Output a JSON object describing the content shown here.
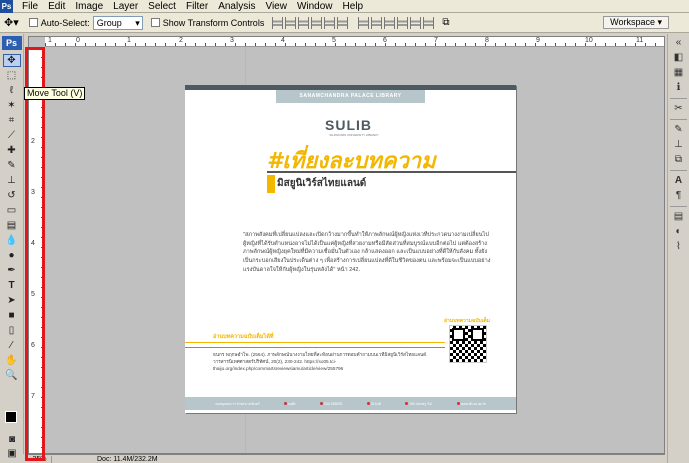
{
  "menu": [
    "File",
    "Edit",
    "Image",
    "Layer",
    "Select",
    "Filter",
    "Analysis",
    "View",
    "Window",
    "Help"
  ],
  "options": {
    "auto_select_label": "Auto-Select:",
    "auto_select_value": "Group",
    "transform_label": "Show Transform Controls",
    "workspace_label": "Workspace"
  },
  "tools": {
    "ps_badge": "Ps",
    "tooltip": "Move Tool (V)"
  },
  "ruler": {
    "top": [
      "1",
      "0",
      "1",
      "2",
      "3",
      "4",
      "5",
      "6",
      "7",
      "8",
      "9",
      "10",
      "11"
    ],
    "left": [
      "1",
      "2",
      "3",
      "4",
      "5",
      "6",
      "7"
    ]
  },
  "document": {
    "library_banner": "SANAMCHANDRA PALACE LIBRARY",
    "logo": "SULIB",
    "logo_sub": "SILPAKORN UNIVERSITY LIBRARY",
    "title": "#เที่ยงละบทความ",
    "subtitle": "มิสยูนิเวิร์สไทยแลนด์",
    "quote": "\"สภาพสังคมที่เปลี่ยนแปลงและเปิดกว้างมากขึ้นทำให้ภาพลักษณ์ผู้หญิงแห่งเวทีประกวดนางงามเปลี่ยนไป ผู้หญิงที่ได้รับตำแหน่งอาจไม่ได้เป็นแค่ผู้หญิงที่สวยงามหรือมีสัดส่วนที่สมบูรณ์แบบอีกต่อไป แต่ต้องสร้างภาพลักษณ์ผู้หญิงยุคใหม่ที่มีความเชื่อมั่นในตัวเอง กล้าแสดงออก และเป็นแบบอย่างที่ดีให้กับสังคม ทั้งยังเป็นกระบอกเสียงในประเด็นต่าง ๆ เพื่อสร้างการเปลี่ยนแปลงที่ดีในชีวิตของตน และพร้อมจะเป็นแบบอย่าง แรงบันดาลใจให้กับผู้หญิงในรุ่นหลังได้\" หน้า 242.",
    "read_more_right": "อ่านบทความฉบับเต็ม",
    "read_more_left": "อ่านบทความฉบับเต็มได้ที่",
    "reference": "ธนกร พฤกษอำไพ. (2564). ภาพลักษณ์นางงามไทยที่สะท้อนผ่านการตอบคำถามบนเวทีมิสยูนิเวิร์สไทยแลนด์. วารสารนิเทศศาสตร์ปริทัศน์, 20(2), 230-242. https://so05.tci-thaijo.org/index.php/commartsreviewsiamu/article/view/255796",
    "footer": [
      "หอสมุดพระราชวังสนามจันทร์",
      "sulib",
      "034 255093",
      "SULIB",
      "SM Library SU",
      "www.lib.su.ac.th"
    ]
  },
  "status": {
    "zoom": "25%",
    "doc": "Doc: 11.4M/232.2M"
  },
  "colors": {
    "annotation": "#e2171c",
    "title_yellow": "#f3b700",
    "banner": "#b6c6cb"
  }
}
